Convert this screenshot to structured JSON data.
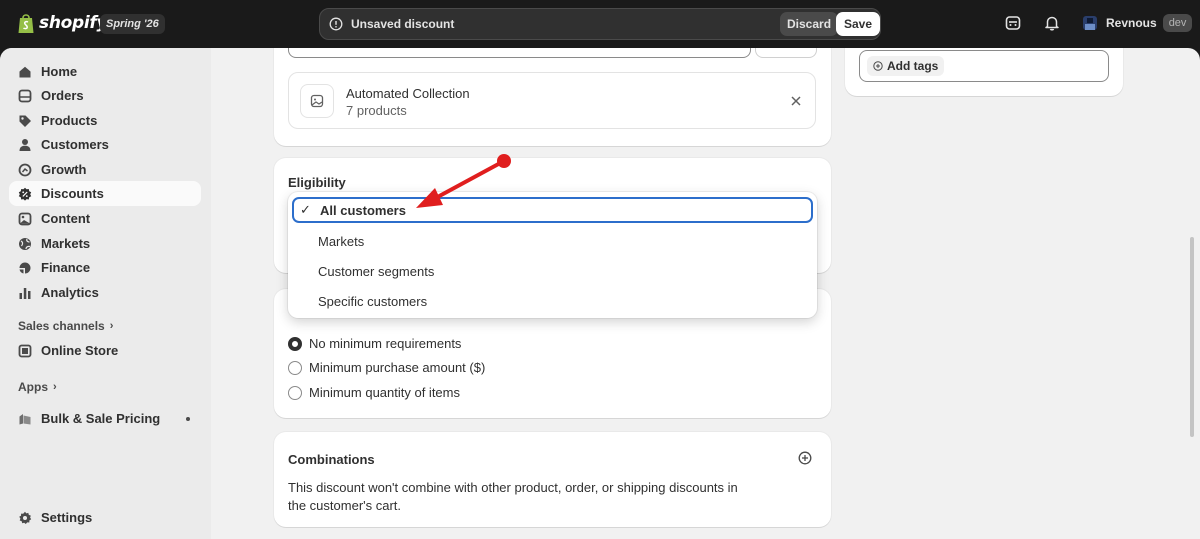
{
  "topbar": {
    "brand": "shopify",
    "edition": "Spring '26",
    "save_bar": {
      "message": "Unsaved discount",
      "discard_label": "Discard",
      "save_label": "Save"
    },
    "user": {
      "name": "Revnous",
      "badge": "dev"
    }
  },
  "sidebar": {
    "items": [
      {
        "label": "Home",
        "icon": "home-icon"
      },
      {
        "label": "Orders",
        "icon": "orders-icon"
      },
      {
        "label": "Products",
        "icon": "tag-icon"
      },
      {
        "label": "Customers",
        "icon": "person-icon"
      },
      {
        "label": "Growth",
        "icon": "growth-icon"
      },
      {
        "label": "Discounts",
        "icon": "discount-icon",
        "active": true
      },
      {
        "label": "Content",
        "icon": "content-icon"
      },
      {
        "label": "Markets",
        "icon": "globe-icon"
      },
      {
        "label": "Finance",
        "icon": "finance-icon"
      },
      {
        "label": "Analytics",
        "icon": "bar-chart-icon"
      }
    ],
    "sales_channels_label": "Sales channels",
    "online_store_label": "Online Store",
    "apps_label": "Apps",
    "app_item_label": "Bulk & Sale Pricing",
    "settings_label": "Settings"
  },
  "collection": {
    "title": "Automated Collection",
    "subtitle": "7 products"
  },
  "eligibility": {
    "title": "Eligibility",
    "options": [
      {
        "label": "All customers",
        "selected": true
      },
      {
        "label": "Markets",
        "selected": false
      },
      {
        "label": "Customer segments",
        "selected": false
      },
      {
        "label": "Specific customers",
        "selected": false
      }
    ]
  },
  "requirements": {
    "options": [
      {
        "label": "No minimum requirements",
        "checked": true
      },
      {
        "label": "Minimum purchase amount ($)",
        "checked": false
      },
      {
        "label": "Minimum quantity of items",
        "checked": false
      }
    ]
  },
  "combinations": {
    "title": "Combinations",
    "text": "This discount won't combine with other product, order, or shipping discounts in the customer's cart."
  },
  "tags": {
    "add_label": "Add tags"
  },
  "colors": {
    "accent_focus": "#2c6ecb",
    "annotation_arrow": "#e01e1e",
    "topbar_bg": "#1a1a1a"
  }
}
